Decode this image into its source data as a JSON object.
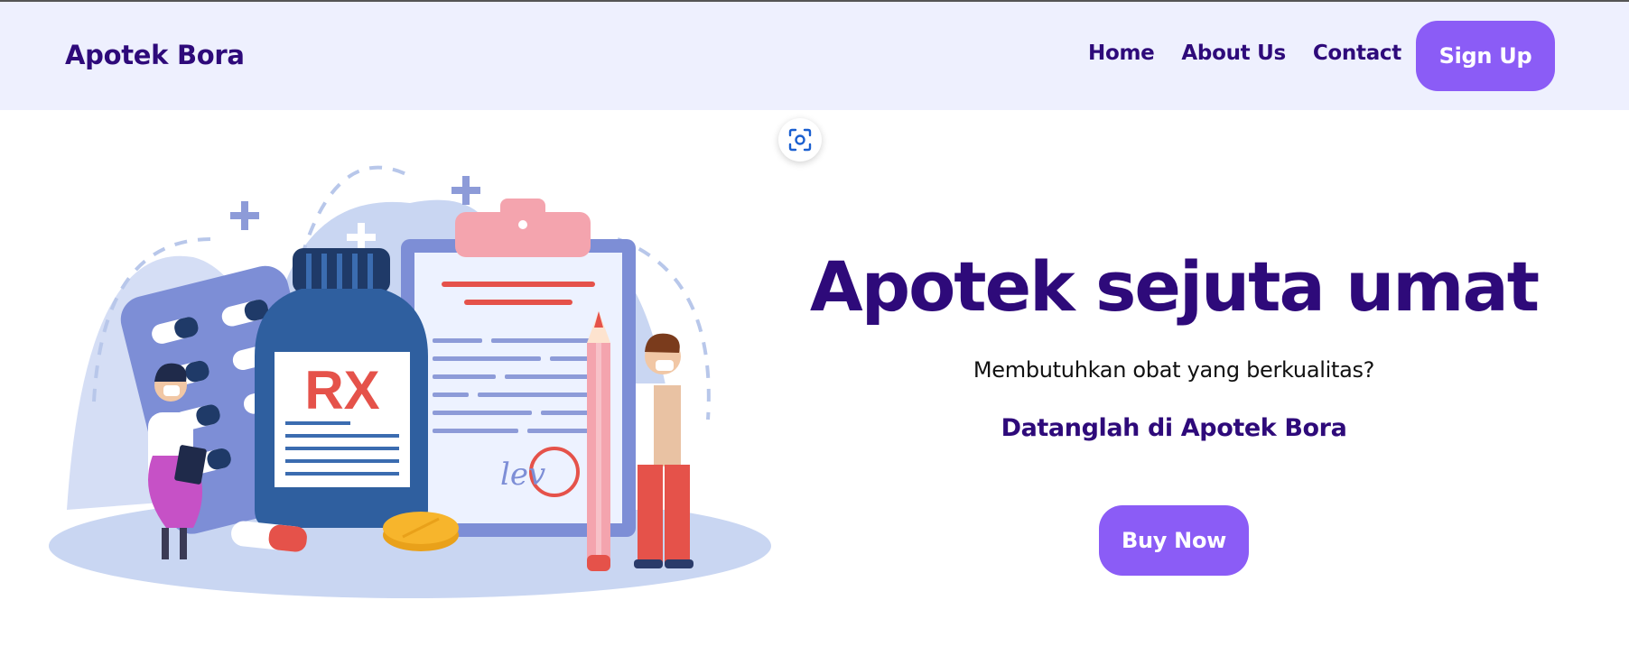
{
  "header": {
    "brand": "Apotek Bora",
    "nav": [
      "Home",
      "About Us",
      "Contact"
    ],
    "signup_label": "Sign Up"
  },
  "illustration": {
    "bottle_label": "RX",
    "signature": "lev"
  },
  "hero": {
    "title": "Apotek sejuta umat",
    "subtitle": "Membutuhkan obat yang berkualitas?",
    "tagline": "Datanglah di Apotek Bora",
    "button_label": "Buy Now"
  },
  "colors": {
    "primary_text": "#2e0a7a",
    "accent_button": "#8b5cf6",
    "header_bg": "#eef0fe"
  },
  "icons": [
    "visual-search-icon"
  ]
}
